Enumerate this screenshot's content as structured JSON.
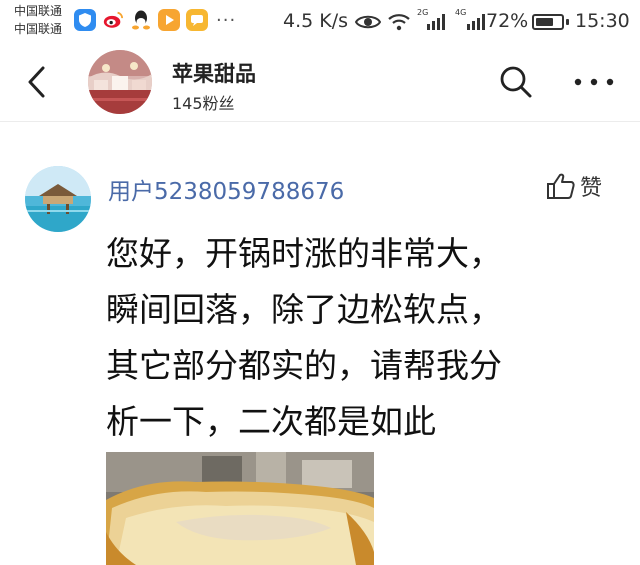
{
  "status_bar": {
    "carrier_1": "中国联通",
    "carrier_2": "中国联通",
    "more": "···",
    "net_speed": "4.5 K/s",
    "sig_2g": "2G",
    "sig_4g": "4G",
    "battery": "72%",
    "battery_level": 0.72,
    "time": "15:30",
    "app_icons": [
      "shield-app-icon",
      "weibo-icon",
      "qq-penguin-icon",
      "video-app-icon",
      "message-app-icon"
    ]
  },
  "header": {
    "title": "苹果甜品",
    "subtitle": "145粉丝",
    "icons": [
      "back-arrow-icon",
      "search-icon",
      "more-horizontal-icon"
    ]
  },
  "comment": {
    "username": "用户5238059788676",
    "like_label": "赞",
    "lines": [
      "您好，开锅时涨的非常大，",
      "瞬间回落，除了边松软点，",
      "其它部分都实的，请帮我分",
      "析一下，二次都是如此"
    ]
  },
  "colors": {
    "username": "#4a6aa8",
    "accent_blue": "#2f8cf0",
    "weibo": "#e6162d",
    "orange": "#f7a531"
  }
}
